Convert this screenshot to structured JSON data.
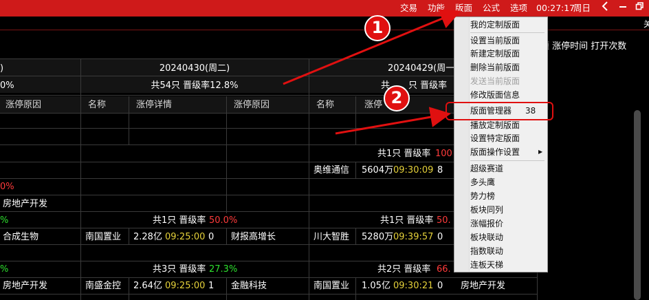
{
  "topbar": {
    "menus": [
      "交易",
      "功能",
      "版面",
      "公式",
      "选项"
    ],
    "clock": "00:27:17",
    "weekday": "周日",
    "icons": [
      "back-icon",
      "minimize-icon",
      "restore-icon"
    ]
  },
  "right_header": "题 涨停时间 打开次数",
  "partial_label": "关",
  "table": {
    "col0_header_date": ")",
    "col0_summary": "0%",
    "col0_reason_header": "涨停原因",
    "date1": "20240430(周二)",
    "summary1": "共54只 晋级率12.8%",
    "date2": "20240429(周一",
    "summary2": "共",
    "summary2_tail": "只 晋级率",
    "headers": [
      "名称",
      "涨停详情",
      "涨停原因",
      "名称",
      "涨停详情"
    ],
    "headers_partial": "涨停"
  },
  "rows": {
    "r_block1": {
      "summary3": "共1只 晋级率",
      "rate3": "100"
    },
    "r_aowei": {
      "name": "奥维通信",
      "amount": "5604万",
      "time": "09:30:09",
      "count": "8"
    },
    "r_pct0": {
      "text": "0%"
    },
    "r_realestate1": {
      "text": "房地产开发"
    },
    "r_block2": {
      "left_pct": "%",
      "summary1": "共1只 晋级率",
      "rate1": "50.0%",
      "summary2": "共1只 晋级率",
      "rate2": "50."
    },
    "r_row2": {
      "reason0": "合成生物",
      "name1": "南国置业",
      "amount1": "2.28亿",
      "time1": "09:25:00",
      "count1": "0",
      "reason1": "财报高增长",
      "name2": "川大智胜",
      "amount2": "5280万",
      "time2": "09:39:57",
      "count2": "0"
    },
    "r_block3": {
      "left_pct": "%",
      "summary1": "共3只 晋级率",
      "rate1": "27.3%",
      "summary2": "共2只 晋级率",
      "rate2": "66."
    },
    "r_row3": {
      "reason0": "房地产开发",
      "name1": "南盛金控",
      "amount1": "2.64亿",
      "time1": "09:25:00",
      "count1": "1",
      "reason1": "金融科技",
      "name2": "南国置业",
      "amount2": "1.05亿",
      "time2": "09:30:21",
      "count2": "0",
      "reason2": "房地产开发"
    }
  },
  "menu": {
    "items": [
      {
        "label": "我的定制版面",
        "disabled": false
      },
      {
        "label": "设置当前版面",
        "disabled": false
      },
      {
        "label": "新建定制版面",
        "disabled": false
      },
      {
        "label": "删除当前版面",
        "disabled": false
      },
      {
        "label": "发送当前版面",
        "disabled": true
      },
      {
        "label": "修改版面信息",
        "disabled": false
      },
      {
        "label": "版面管理器",
        "shortcut": "38",
        "disabled": false
      },
      {
        "label": "播放定制版面",
        "disabled": false
      },
      {
        "label": "设置特定版面",
        "disabled": false
      },
      {
        "label": "版面操作设置",
        "submenu": true,
        "disabled": false
      },
      {
        "label": "超级赛道",
        "disabled": false
      },
      {
        "label": "多头鹰",
        "disabled": false
      },
      {
        "label": "势力榜",
        "disabled": false
      },
      {
        "label": "板块同列",
        "disabled": false
      },
      {
        "label": "涨幅报价",
        "disabled": false
      },
      {
        "label": "板块联动",
        "disabled": false
      },
      {
        "label": "指数联动",
        "disabled": false
      },
      {
        "label": "连板天梯",
        "disabled": false
      }
    ]
  },
  "annotations": {
    "badge1": "1",
    "badge2": "2"
  },
  "colors": {
    "topbar": "#cf1a1a",
    "up_red": "#ff3b3b",
    "green": "#2ee12e",
    "time_yellow": "#e6d23a",
    "annotation_red": "#e01010"
  }
}
